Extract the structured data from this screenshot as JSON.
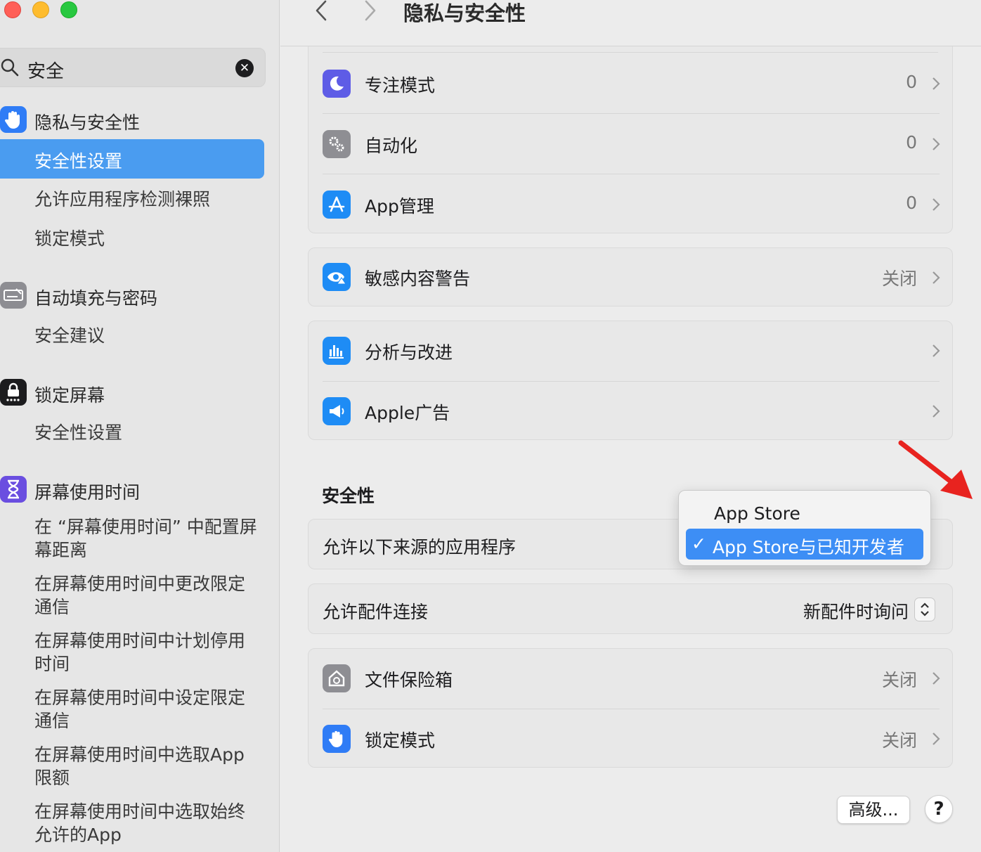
{
  "sidebar": {
    "search_value": "安全",
    "groups": [
      {
        "title": "隐私与安全性",
        "icon": "hand-raised-icon",
        "items": [
          "安全性设置",
          "允许应用程序检测裸照",
          "锁定模式"
        ]
      },
      {
        "title": "自动填充与密码",
        "icon": "keyboard-icon",
        "items": [
          "安全建议"
        ]
      },
      {
        "title": "锁定屏幕",
        "icon": "lock-screen-icon",
        "items": [
          "安全性设置"
        ]
      },
      {
        "title": "屏幕使用时间",
        "icon": "hourglass-icon",
        "items": [
          "在 “屏幕使用时间” 中配置屏幕距离",
          "在屏幕使用时间中更改限定通信",
          "在屏幕使用时间中计划停用时间",
          "在屏幕使用时间中设定限定通信",
          "在屏幕使用时间中选取App限额",
          "在屏幕使用时间中选取始终允许的App"
        ]
      }
    ],
    "selected": "安全性设置"
  },
  "toolbar": {
    "title": "隐私与安全性"
  },
  "cards": {
    "top": [
      {
        "label": "专注模式",
        "value": "0",
        "icon": "moon-icon"
      },
      {
        "label": "自动化",
        "value": "0",
        "icon": "gears-icon"
      },
      {
        "label": "App管理",
        "value": "0",
        "icon": "app-store-icon"
      }
    ],
    "sensitive": {
      "label": "敏感内容警告",
      "value": "关闭",
      "icon": "eye-warning-icon"
    },
    "analytics": [
      {
        "label": "分析与改进",
        "icon": "bar-chart-icon"
      },
      {
        "label": "Apple广告",
        "icon": "megaphone-icon"
      }
    ]
  },
  "security": {
    "section_title": "安全性",
    "allow_from_label": "允许以下来源的应用程序",
    "menu": {
      "option1": "App Store",
      "option2": "App Store与已知开发者",
      "checkmark": "✓"
    },
    "accessory_label": "允许配件连接",
    "accessory_value": "新配件时询问",
    "filevault": {
      "label": "文件保险箱",
      "value": "关闭"
    },
    "lockdown": {
      "label": "锁定模式",
      "value": "关闭"
    }
  },
  "footer": {
    "advanced": "高级...",
    "help": "?"
  },
  "colors": {
    "accent": "#3d8ef5",
    "sidebar_selected": "#4a9cf0",
    "annotation_arrow": "#e8231f"
  }
}
